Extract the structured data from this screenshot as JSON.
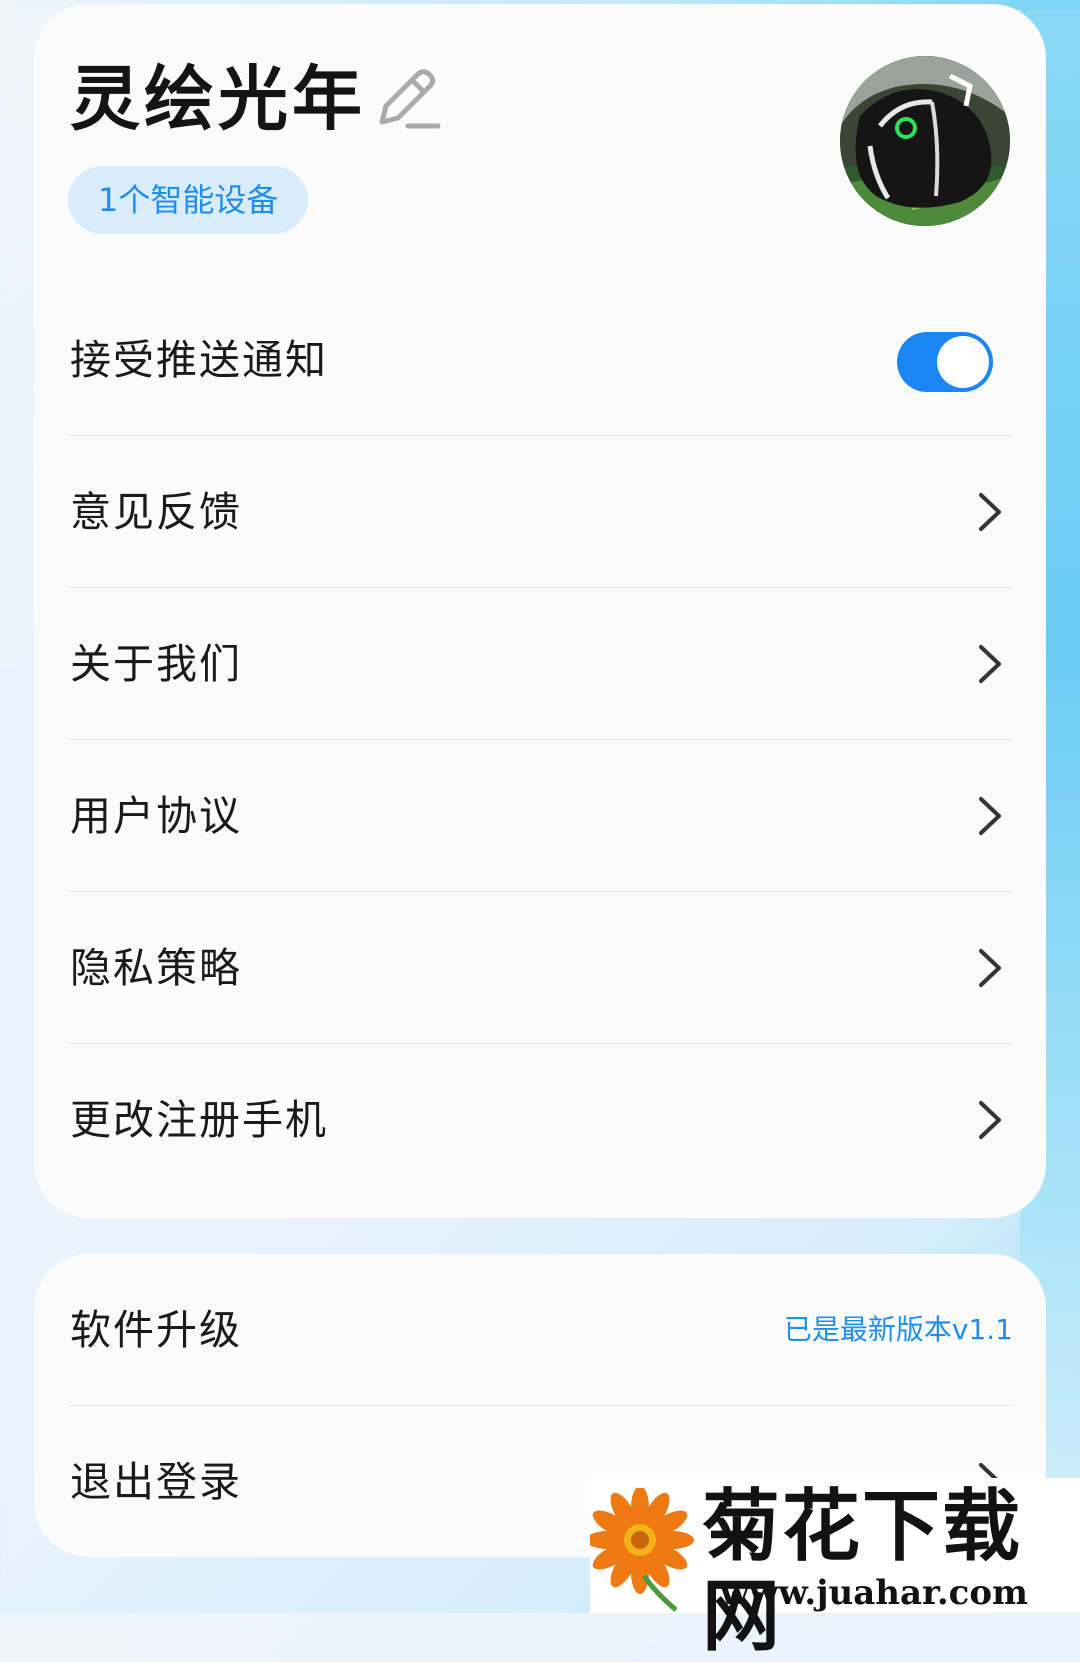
{
  "profile": {
    "name": "灵绘光年",
    "device_badge": "1个智能设备",
    "edit_icon": "pencil-icon",
    "avatar": "avatar-photo"
  },
  "settings": {
    "items": [
      {
        "label": "接受推送通知",
        "control": "toggle",
        "toggle_on": true
      },
      {
        "label": "意见反馈",
        "control": "chevron"
      },
      {
        "label": "关于我们",
        "control": "chevron"
      },
      {
        "label": "用户协议",
        "control": "chevron"
      },
      {
        "label": "隐私策略",
        "control": "chevron"
      },
      {
        "label": "更改注册手机",
        "control": "chevron"
      }
    ]
  },
  "system": {
    "update_label": "软件升级",
    "update_status": "已是最新版本v1.1",
    "logout_label": "退出登录"
  },
  "watermark": {
    "title": "菊花下载网",
    "url": "www.juahar.com"
  },
  "colors": {
    "accent": "#1a86f2",
    "badge_bg": "#d9ecfb",
    "card_bg": "#fbfbfb"
  }
}
